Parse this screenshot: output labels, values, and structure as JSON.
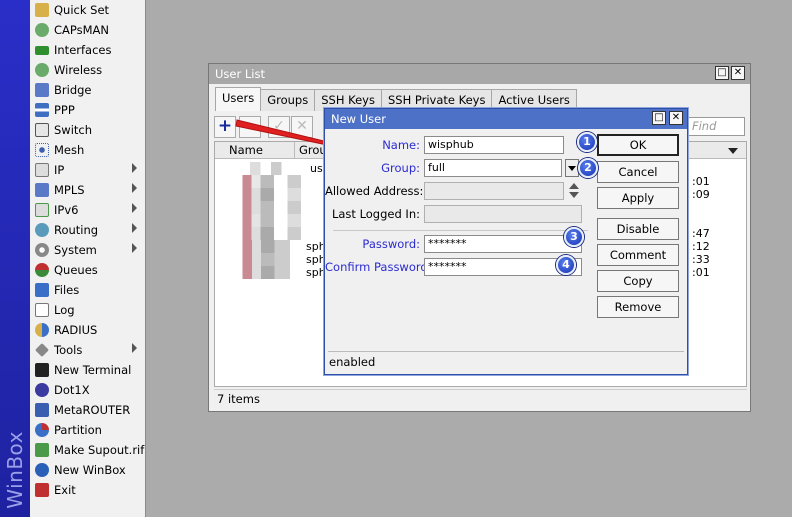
{
  "sidebar": {
    "brand": "WinBox",
    "items": [
      {
        "label": "Quick Set",
        "icon": "wand-icon",
        "color": "#c89a2a"
      },
      {
        "label": "CAPsMAN",
        "icon": "antenna-icon",
        "color": "#4a9a4a"
      },
      {
        "label": "Interfaces",
        "icon": "interfaces-icon",
        "color": "#2f8f2f"
      },
      {
        "label": "Wireless",
        "icon": "wireless-icon",
        "color": "#4a9a4a"
      },
      {
        "label": "Bridge",
        "icon": "bridge-icon",
        "color": "#4a6ab8"
      },
      {
        "label": "PPP",
        "icon": "ppp-icon",
        "color": "#3f6fc0"
      },
      {
        "label": "Switch",
        "icon": "switch-icon",
        "color": "#555555"
      },
      {
        "label": "Mesh",
        "icon": "mesh-icon",
        "color": "#3a5fb0"
      },
      {
        "label": "IP",
        "icon": "ip-icon",
        "color": "#888888"
      },
      {
        "label": "MPLS",
        "icon": "mpls-icon",
        "color": "#3f6fc0"
      },
      {
        "label": "IPv6",
        "icon": "ipv6-icon",
        "color": "#4a9a4a"
      },
      {
        "label": "Routing",
        "icon": "routing-icon",
        "color": "#3a7a9a"
      },
      {
        "label": "System",
        "icon": "gear-icon",
        "color": "#7a7a7a"
      },
      {
        "label": "Queues",
        "icon": "queues-icon",
        "color": "#b03030"
      },
      {
        "label": "Files",
        "icon": "folder-icon",
        "color": "#3a6fc8"
      },
      {
        "label": "Log",
        "icon": "log-icon",
        "color": "#e8e8e8"
      },
      {
        "label": "RADIUS",
        "icon": "radius-icon",
        "color": "#c8a030"
      },
      {
        "label": "Tools",
        "icon": "tools-icon",
        "color": "#666666"
      },
      {
        "label": "New Terminal",
        "icon": "terminal-icon",
        "color": "#222222"
      },
      {
        "label": "Dot1X",
        "icon": "dot1x-icon",
        "color": "#2f2f8f"
      },
      {
        "label": "MetaROUTER",
        "icon": "metarouter-icon",
        "color": "#3a5fb0"
      },
      {
        "label": "Partition",
        "icon": "partition-icon",
        "color": "#c03030"
      },
      {
        "label": "Make Supout.rif",
        "icon": "supout-icon",
        "color": "#3a8a3a"
      },
      {
        "label": "New WinBox",
        "icon": "winbox-icon",
        "color": "#2a5fb8"
      },
      {
        "label": "Exit",
        "icon": "exit-icon",
        "color": "#c03030"
      }
    ]
  },
  "user_list": {
    "title": "User List",
    "tabs": [
      "Users",
      "Groups",
      "SSH Keys",
      "SSH Private Keys",
      "Active Users"
    ],
    "find_placeholder": "Find",
    "columns": {
      "name": "Name",
      "group": "Group"
    },
    "rows": [
      {
        "group": "us",
        "tail": ""
      },
      {
        "group": "",
        "tail": ":01"
      },
      {
        "group": "",
        "tail": ":09"
      },
      {
        "group": "",
        "tail": ""
      },
      {
        "group": "",
        "tail": ""
      },
      {
        "group": "",
        "tail": ":47"
      },
      {
        "group": "sph",
        "tail": ":12"
      },
      {
        "group": "sph",
        "tail": ":33"
      },
      {
        "group": "sph",
        "tail": ":01"
      }
    ],
    "status": "7 items"
  },
  "new_user": {
    "title": "New User",
    "fields": {
      "name_label": "Name:",
      "name_value": "wisphub",
      "group_label": "Group:",
      "group_value": "full",
      "allowed_address_label": "Allowed Address:",
      "last_logged_in_label": "Last Logged In:",
      "password_label": "Password:",
      "password_value": "*******",
      "confirm_label": "Confirm Password:",
      "confirm_value": "*******"
    },
    "buttons": {
      "ok": "OK",
      "cancel": "Cancel",
      "apply": "Apply",
      "disable": "Disable",
      "comment": "Comment",
      "copy": "Copy",
      "remove": "Remove"
    },
    "status": "enabled"
  },
  "annotations": {
    "badges": [
      "1",
      "2",
      "3",
      "4"
    ],
    "badge_color": "#1533b0",
    "arrow_color": "#e02020"
  }
}
